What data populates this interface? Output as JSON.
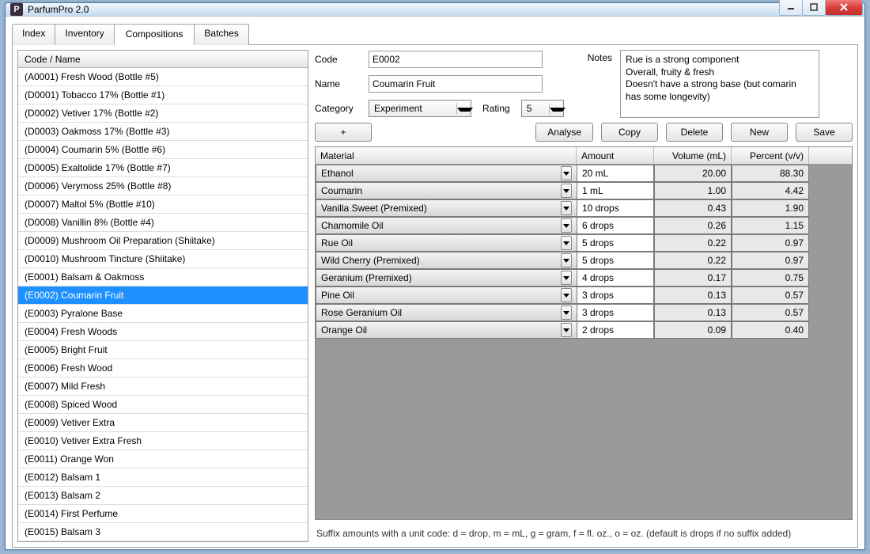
{
  "window": {
    "title": "ParfumPro 2.0"
  },
  "tabs": [
    {
      "label": "Index"
    },
    {
      "label": "Inventory"
    },
    {
      "label": "Compositions"
    },
    {
      "label": "Batches"
    }
  ],
  "active_tab": 2,
  "list": {
    "header": "Code / Name",
    "selected_index": 11,
    "items": [
      "(A0001) Fresh Wood (Bottle #5)",
      "(D0001) Tobacco 17% (Bottle #1)",
      "(D0002) Vetiver 17% (Bottle #2)",
      "(D0003) Oakmoss 17% (Bottle #3)",
      "(D0004) Coumarin 5% (Bottle #6)",
      "(D0005) Exaltolide 17% (Bottle #7)",
      "(D0006) Verymoss 25% (Bottle #8)",
      "(D0007) Maltol 5% (Bottle #10)",
      "(D0008) Vanillin 8% (Bottle #4)",
      "(D0009) Mushroom Oil Preparation (Shiitake)",
      "(D0010) Mushroom Tincture (Shiitake)",
      "(E0001) Balsam & Oakmoss",
      "(E0002) Coumarin Fruit",
      "(E0003) Pyralone Base",
      "(E0004) Fresh Woods",
      "(E0005) Bright Fruit",
      "(E0006) Fresh Wood",
      "(E0007) Mild Fresh",
      "(E0008) Spiced Wood",
      "(E0009) Vetiver Extra",
      "(E0010) Vetiver Extra Fresh",
      "(E0011) Orange Won",
      "(E0012) Balsam 1",
      "(E0013) Balsam 2",
      "(E0014) First Perfume",
      "(E0015) Balsam 3"
    ]
  },
  "form": {
    "code_label": "Code",
    "code_value": "E0002",
    "name_label": "Name",
    "name_value": "Coumarin Fruit",
    "category_label": "Category",
    "category_value": "Experiment",
    "rating_label": "Rating",
    "rating_value": "5",
    "notes_label": "Notes",
    "notes_value": "Rue is a strong component\nOverall, fruity & fresh\nDoesn't have a strong base (but comarin has some longevity)"
  },
  "buttons": {
    "add": "+",
    "analyse": "Analyse",
    "copy": "Copy",
    "delete": "Delete",
    "new": "New",
    "save": "Save"
  },
  "grid": {
    "headers": {
      "material": "Material",
      "amount": "Amount",
      "volume": "Volume (mL)",
      "percent": "Percent (v/v)"
    },
    "rows": [
      {
        "material": "Ethanol",
        "amount": "20 mL",
        "volume": "20.00",
        "percent": "88.30"
      },
      {
        "material": "Coumarin",
        "amount": "1 mL",
        "volume": "1.00",
        "percent": "4.42"
      },
      {
        "material": "Vanilla Sweet (Premixed)",
        "amount": "10 drops",
        "volume": "0.43",
        "percent": "1.90"
      },
      {
        "material": "Chamomile Oil",
        "amount": "6 drops",
        "volume": "0.26",
        "percent": "1.15"
      },
      {
        "material": "Rue Oil",
        "amount": "5 drops",
        "volume": "0.22",
        "percent": "0.97"
      },
      {
        "material": "Wild Cherry (Premixed)",
        "amount": "5 drops",
        "volume": "0.22",
        "percent": "0.97"
      },
      {
        "material": "Geranium (Premixed)",
        "amount": "4 drops",
        "volume": "0.17",
        "percent": "0.75"
      },
      {
        "material": "Pine Oil",
        "amount": "3 drops",
        "volume": "0.13",
        "percent": "0.57"
      },
      {
        "material": "Rose Geranium Oil",
        "amount": "3 drops",
        "volume": "0.13",
        "percent": "0.57"
      },
      {
        "material": "Orange Oil",
        "amount": "2 drops",
        "volume": "0.09",
        "percent": "0.40"
      }
    ]
  },
  "hint": "Suffix amounts with a unit code: d = drop, m = mL, g = gram, f = fl. oz., o = oz. (default is drops if no suffix added)"
}
